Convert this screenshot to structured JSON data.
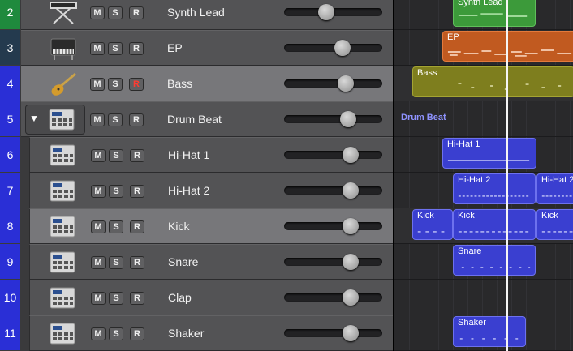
{
  "track_buttons": {
    "mute": "M",
    "solo": "S",
    "record": "R"
  },
  "tracks": [
    {
      "number": "2",
      "name": "Synth Lead",
      "icon": "keyboard-icon",
      "volume": 0.42
    },
    {
      "number": "3",
      "name": "EP",
      "icon": "electric-piano-icon",
      "volume": 0.61
    },
    {
      "number": "4",
      "name": "Bass",
      "icon": "bass-guitar-icon",
      "volume": 0.65,
      "record_armed": true
    },
    {
      "number": "5",
      "name": "Drum Beat",
      "icon": "drum-machine-icon",
      "volume": 0.68,
      "folder": true
    },
    {
      "number": "6",
      "name": "Hi-Hat 1",
      "icon": "drum-machine-icon",
      "volume": 0.71
    },
    {
      "number": "7",
      "name": "Hi-Hat 2",
      "icon": "drum-machine-icon",
      "volume": 0.71
    },
    {
      "number": "8",
      "name": "Kick",
      "icon": "drum-machine-icon",
      "volume": 0.71
    },
    {
      "number": "9",
      "name": "Snare",
      "icon": "drum-machine-icon",
      "volume": 0.71
    },
    {
      "number": "10",
      "name": "Clap",
      "icon": "drum-machine-icon",
      "volume": 0.71
    },
    {
      "number": "11",
      "name": "Shaker",
      "icon": "drum-machine-icon",
      "volume": 0.71
    }
  ],
  "regions": {
    "synth_lead": "Synth Lead",
    "ep": "EP",
    "bass": "Bass",
    "drum_beat": "Drum Beat",
    "hihat1": "Hi-Hat 1",
    "hihat2": "Hi-Hat 2",
    "kick": "Kick",
    "snare": "Snare",
    "shaker": "Shaker"
  },
  "colors": {
    "track_number_background": "#2a2fd6",
    "synth_region": "#3c9a3a",
    "ep_region": "#c15a20",
    "bass_region": "#7e7e1e",
    "drum_region": "#3a3fd0"
  }
}
